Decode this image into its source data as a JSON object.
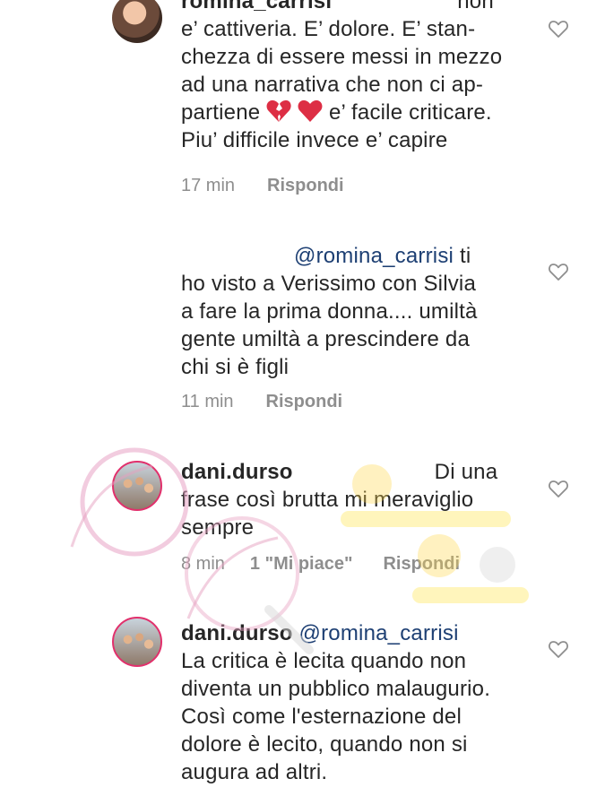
{
  "comments": [
    {
      "username": "romina_carrisi",
      "line1_tail": "non",
      "lines": [
        "e’ cattiveria. E’ dolore. E’ stan-",
        "chezza di essere messi in mezzo",
        "ad una narrativa che non ci ap-"
      ],
      "line5_pre": "partiene",
      "line5_post": "e’ facile criticare.",
      "line6": "Piu’ difficile invece e’ capire",
      "time": "17 min",
      "reply": "Rispondi"
    },
    {
      "mention": "@romina_carrisi",
      "line1_tail": "ti",
      "lines": [
        "ho visto a Verissimo con Silvia",
        "a fare la prima donna.... umiltà",
        "gente umiltà a prescindere da",
        "chi si è figli"
      ],
      "time": "11 min",
      "reply": "Rispondi"
    },
    {
      "username": "dani.durso",
      "line1_tail": "Di una",
      "lines": [
        "frase così brutta mi meraviglio",
        "sempre"
      ],
      "time": "8 min",
      "likes": "1 \"Mi piace\"",
      "reply": "Rispondi"
    },
    {
      "username": "dani.durso",
      "mention": "@romina_carrisi",
      "lines": [
        "La critica è lecita quando non",
        "diventa un pubblico malaugurio.",
        "Così come l'esternazione del",
        "dolore è lecito, quando non si",
        "augura ad altri."
      ]
    }
  ],
  "icons": {
    "heart": "heart-outline-icon",
    "broken_heart": "broken-heart-emoji",
    "red_heart": "red-heart-emoji"
  },
  "colors": {
    "mention": "#1d3f73",
    "meta": "#8e8e8e",
    "heart_emoji": "#dd2e44"
  }
}
